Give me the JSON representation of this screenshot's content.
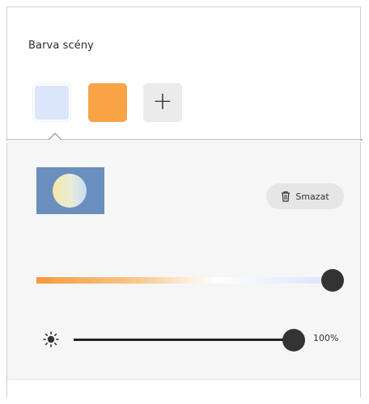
{
  "panel": {
    "title": "Barva scény"
  },
  "swatches": [
    {
      "name": "light-blue",
      "color": "#dce6fb",
      "selected": true
    },
    {
      "name": "orange",
      "color": "#f9a347",
      "selected": false
    }
  ],
  "add_swatch": {
    "icon": "plus-icon",
    "glyph": "+"
  },
  "editor": {
    "preview_bg": "#6a8ebd",
    "delete_label": "Smazat",
    "delete_icon": "trash-icon",
    "temperature": {
      "value": 1.0,
      "gradient": [
        "#f59a3c",
        "#f8c98f",
        "#ffffff",
        "#d9e3fa"
      ]
    },
    "brightness": {
      "icon": "sun-icon",
      "value": 100,
      "label": "100%"
    }
  }
}
